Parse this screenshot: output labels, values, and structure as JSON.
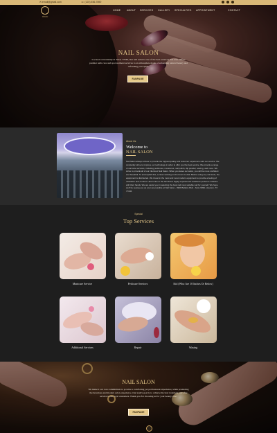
{
  "topbar": {
    "email": "✉ email@gmail.com",
    "phone": "☏ (123) 456-7890",
    "social": [
      "facebook-icon",
      "twitter-icon",
      "instagram-icon"
    ]
  },
  "brand": {
    "logo_text": "OKAU"
  },
  "nav": {
    "items": [
      "HOME",
      "ABOUT",
      "SERVICES",
      "GALLERY",
      "SPECIALTIES",
      "APPOINTMENT",
      "CONTACT"
    ]
  },
  "hero": {
    "title": "NAIL SALON",
    "text": "Located conveniently in Texas 77036, Our nail salon is one of the best salons in this area. Offers premier nails care and spa treatment services to an atmosphere made of enhancing natural beauty and refreshing your spirit.",
    "button": "FANPAGE"
  },
  "welcome": {
    "eyebrow": "About Us",
    "heading_line1": "Welcome to",
    "heading_line2": "NAIL SALON",
    "text": "Nail Salon always strives to provide the highest quality and customer experience with our service. We constantly strive to improve our technology in order to offer you the best service. We provide a range of nail care services, including pedicures, manicures, nail polish, dip powder, waxing, and more. We strive to provide all of our clients at Nail Salon. When you leave our salon, you will be more confident and beautiful. To accomplish this, a clean working environment is vital. Before using any nail tools, the equipment is disinfected. We invest in the most and most modern equipment to provide a feeling of relaxation and comfort. Here's due to the fact that a highly experienced workforce performs miracles with their hands. We are assist you in selecting the best nail most suitable nail for yourself. We hope we'll be seeing you as soon as possible at Nail Salon - 9999 Bellaire Blvd., Suite 9999, Houston, TX 77036"
  },
  "services": {
    "eyebrow": "Special",
    "title": "Top Services",
    "items": [
      {
        "label": "Manicure Service"
      },
      {
        "label": "Pedicure Services"
      },
      {
        "label": "Kid (Who Are 10 Inches Or Below)"
      },
      {
        "label": "Additional Services"
      },
      {
        "label": "Repair"
      },
      {
        "label": "Waxing"
      }
    ]
  },
  "bottom": {
    "title": "NAIL SALON",
    "text": "We make it our core commitment to provide a comforting yet professional experience, while promoting the luxurious and modern salon experience. Our team's goal is to achieve the best treatment and after service to our loyal customers. Thank you for choosing us for your beauty care!",
    "button": "FANPAGE"
  },
  "colors": {
    "gold": "#e6c98a",
    "topbar": "#d9b877",
    "dark": "#1e1e1e"
  }
}
